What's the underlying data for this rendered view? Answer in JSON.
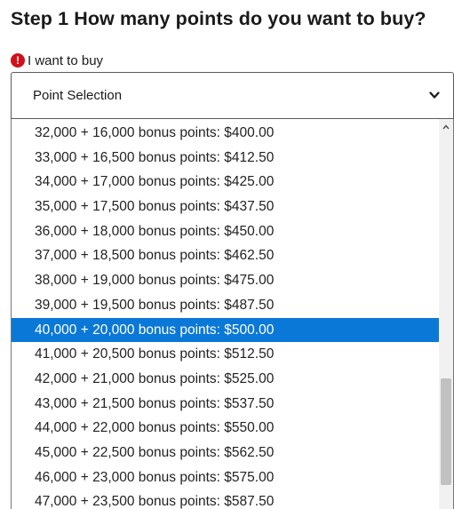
{
  "step": {
    "title": "Step 1 How many points do you want to buy?"
  },
  "field": {
    "error_icon_glyph": "!",
    "label": "I want to buy",
    "error_color": "#d0101a"
  },
  "select": {
    "placeholder": "Point Selection",
    "options": [
      "32,000 + 16,000 bonus points: $400.00",
      "33,000 + 16,500 bonus points: $412.50",
      "34,000 + 17,000 bonus points: $425.00",
      "35,000 + 17,500 bonus points: $437.50",
      "36,000 + 18,000 bonus points: $450.00",
      "37,000 + 18,500 bonus points: $462.50",
      "38,000 + 19,000 bonus points: $475.00",
      "39,000 + 19,500 bonus points: $487.50",
      "40,000 + 20,000 bonus points: $500.00",
      "41,000 + 20,500 bonus points: $512.50",
      "42,000 + 21,000 bonus points: $525.00",
      "43,000 + 21,500 bonus points: $537.50",
      "44,000 + 22,000 bonus points: $550.00",
      "45,000 + 22,500 bonus points: $562.50",
      "46,000 + 23,000 bonus points: $575.00",
      "47,000 + 23,500 bonus points: $587.50"
    ],
    "highlighted_index": 8,
    "highlight_color": "#0a78d7"
  }
}
